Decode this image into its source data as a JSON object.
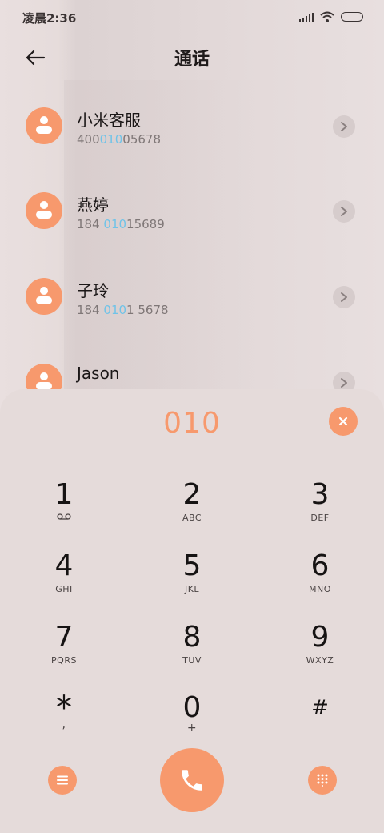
{
  "status_bar": {
    "time": "凌晨2:36",
    "icons": [
      "signal-icon",
      "wifi-icon",
      "battery-icon"
    ]
  },
  "header": {
    "title": "通话",
    "back_icon": "back-arrow-icon"
  },
  "contacts": [
    {
      "name": "小米客服",
      "number_before": "400",
      "number_match": "010",
      "number_after": "05678"
    },
    {
      "name": "燕婷",
      "number_before": "184 ",
      "number_match": "010",
      "number_after": "15689"
    },
    {
      "name": "子玲",
      "number_before": "184 ",
      "number_match": "010",
      "number_after": "1 5678"
    },
    {
      "name": "Jason",
      "number_before": "",
      "number_match": "",
      "number_after": ""
    }
  ],
  "dialpad": {
    "input": "010",
    "keys": [
      {
        "digit": "1",
        "letters": "",
        "icon": "voicemail-icon"
      },
      {
        "digit": "2",
        "letters": "ABC"
      },
      {
        "digit": "3",
        "letters": "DEF"
      },
      {
        "digit": "4",
        "letters": "GHI"
      },
      {
        "digit": "5",
        "letters": "JKL"
      },
      {
        "digit": "6",
        "letters": "MNO"
      },
      {
        "digit": "7",
        "letters": "PQRS"
      },
      {
        "digit": "8",
        "letters": "TUV"
      },
      {
        "digit": "9",
        "letters": "WXYZ"
      },
      {
        "digit": "*",
        "letters": ","
      },
      {
        "digit": "0",
        "letters": "+"
      },
      {
        "digit": "#",
        "letters": ""
      }
    ]
  },
  "colors": {
    "accent": "#f7996d",
    "match_highlight": "#6fc3e8",
    "background": "#e5dbda"
  }
}
